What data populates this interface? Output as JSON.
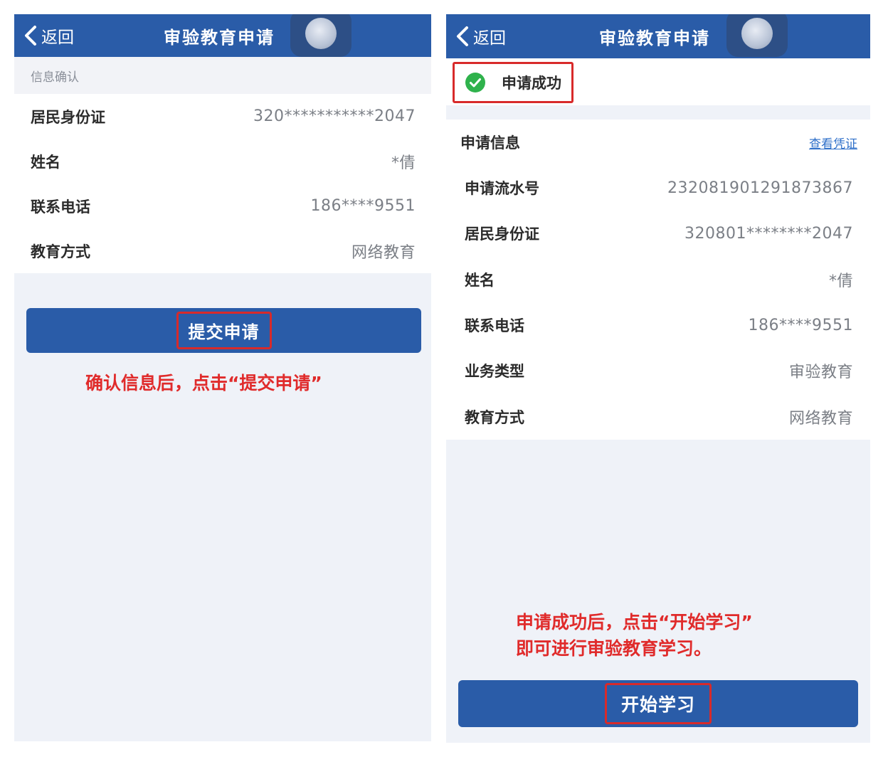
{
  "left": {
    "nav": {
      "back_label": "返回",
      "title": "审验教育申请"
    },
    "section_label": "信息确认",
    "rows": [
      {
        "label": "居民身份证",
        "value": "320***********2047"
      },
      {
        "label": "姓名",
        "value": "*倩"
      },
      {
        "label": "联系电话",
        "value": "186****9551"
      },
      {
        "label": "教育方式",
        "value": "网络教育"
      }
    ],
    "submit_label": "提交申请",
    "note": "确认信息后，点击“提交申请”"
  },
  "right": {
    "nav": {
      "back_label": "返回",
      "title": "审验教育申请"
    },
    "success_text": "申请成功",
    "card_title": "申请信息",
    "card_link": "查看凭证",
    "rows": [
      {
        "label": "申请流水号",
        "value": "232081901291873867"
      },
      {
        "label": "居民身份证",
        "value": "320801********2047"
      },
      {
        "label": "姓名",
        "value": "*倩"
      },
      {
        "label": "联系电话",
        "value": "186****9551"
      },
      {
        "label": "业务类型",
        "value": "审验教育"
      },
      {
        "label": "教育方式",
        "value": "网络教育"
      }
    ],
    "note_line1": "申请成功后，点击“开始学习”",
    "note_line2": "即可进行审验教育学习。",
    "start_label": "开始学习"
  },
  "colors": {
    "brand_blue": "#2a5ca8",
    "highlight_red": "#d82a2a",
    "success_green": "#2fb24c",
    "link_blue": "#2e6fc9"
  },
  "icons": [
    "chevron-left-icon",
    "floating-assistant-icon",
    "check-circle-icon"
  ]
}
